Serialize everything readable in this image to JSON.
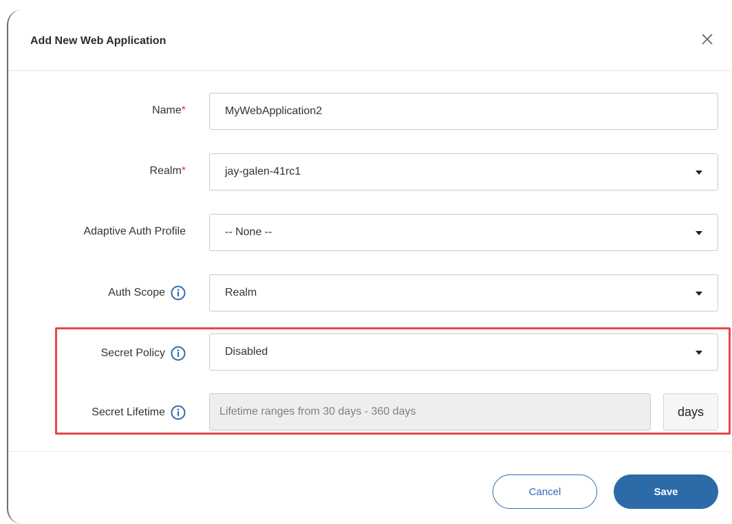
{
  "dialog": {
    "title": "Add New Web Application",
    "close_icon": "close-icon"
  },
  "form": {
    "name": {
      "label": "Name",
      "required_mark": "*",
      "value": "MyWebApplication2"
    },
    "realm": {
      "label": "Realm",
      "required_mark": "*",
      "value": "jay-galen-41rc1"
    },
    "adaptive_auth_profile": {
      "label": "Adaptive Auth Profile",
      "value": "-- None --"
    },
    "auth_scope": {
      "label": "Auth Scope",
      "value": "Realm",
      "info_icon": "info-icon"
    },
    "secret_policy": {
      "label": "Secret Policy",
      "value": "Disabled",
      "info_icon": "info-icon"
    },
    "secret_lifetime": {
      "label": "Secret Lifetime",
      "placeholder": "Lifetime ranges from 30 days - 360 days",
      "value": "",
      "unit": "days",
      "info_icon": "info-icon"
    }
  },
  "footer": {
    "cancel_label": "Cancel",
    "save_label": "Save"
  },
  "colors": {
    "accent": "#2d6aa8",
    "required": "#e0393e",
    "highlight": "#e5464a"
  }
}
